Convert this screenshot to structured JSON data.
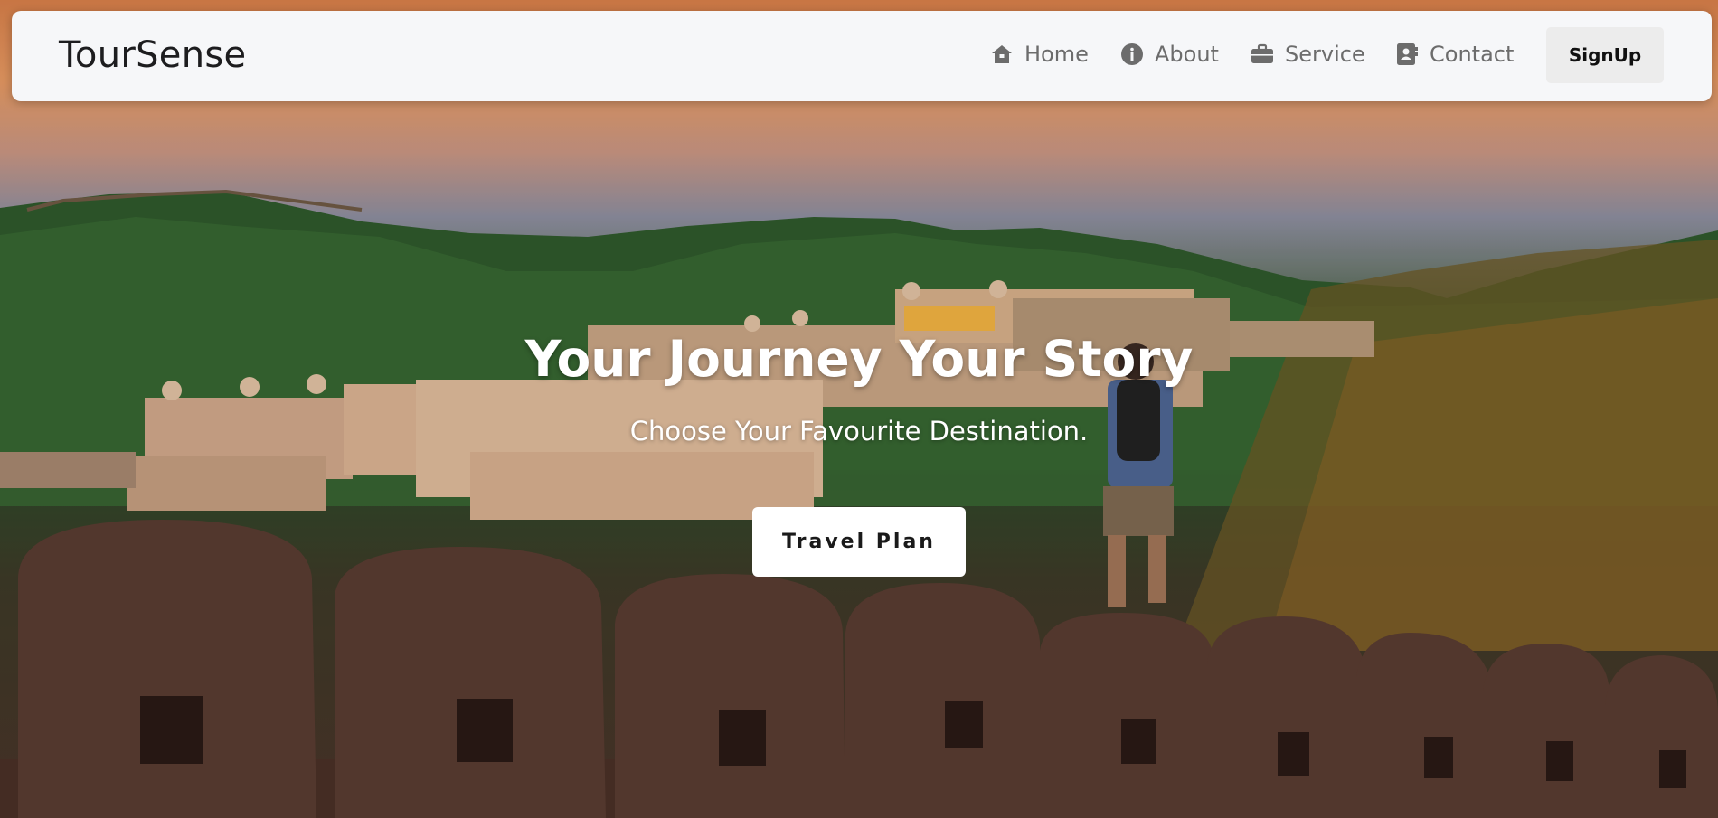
{
  "brand": {
    "name": "TourSense"
  },
  "nav": {
    "items": [
      {
        "label": "Home",
        "icon": "home-icon"
      },
      {
        "label": "About",
        "icon": "info-icon"
      },
      {
        "label": "Service",
        "icon": "briefcase-icon"
      },
      {
        "label": "Contact",
        "icon": "contact-book-icon"
      }
    ],
    "signup_label": "SignUp"
  },
  "hero": {
    "title": "Your Journey Your Story",
    "subtitle": "Choose Your Favourite Destination.",
    "cta_label": "Travel Plan",
    "background": "fort-landscape-sunset-image"
  },
  "colors": {
    "navbar_bg": "#f6f7f9",
    "nav_text": "#6c6c6c",
    "brand_text": "#1d1d1f",
    "signup_bg": "#ececec",
    "cta_bg": "#ffffff",
    "hero_text": "#ffffff"
  }
}
